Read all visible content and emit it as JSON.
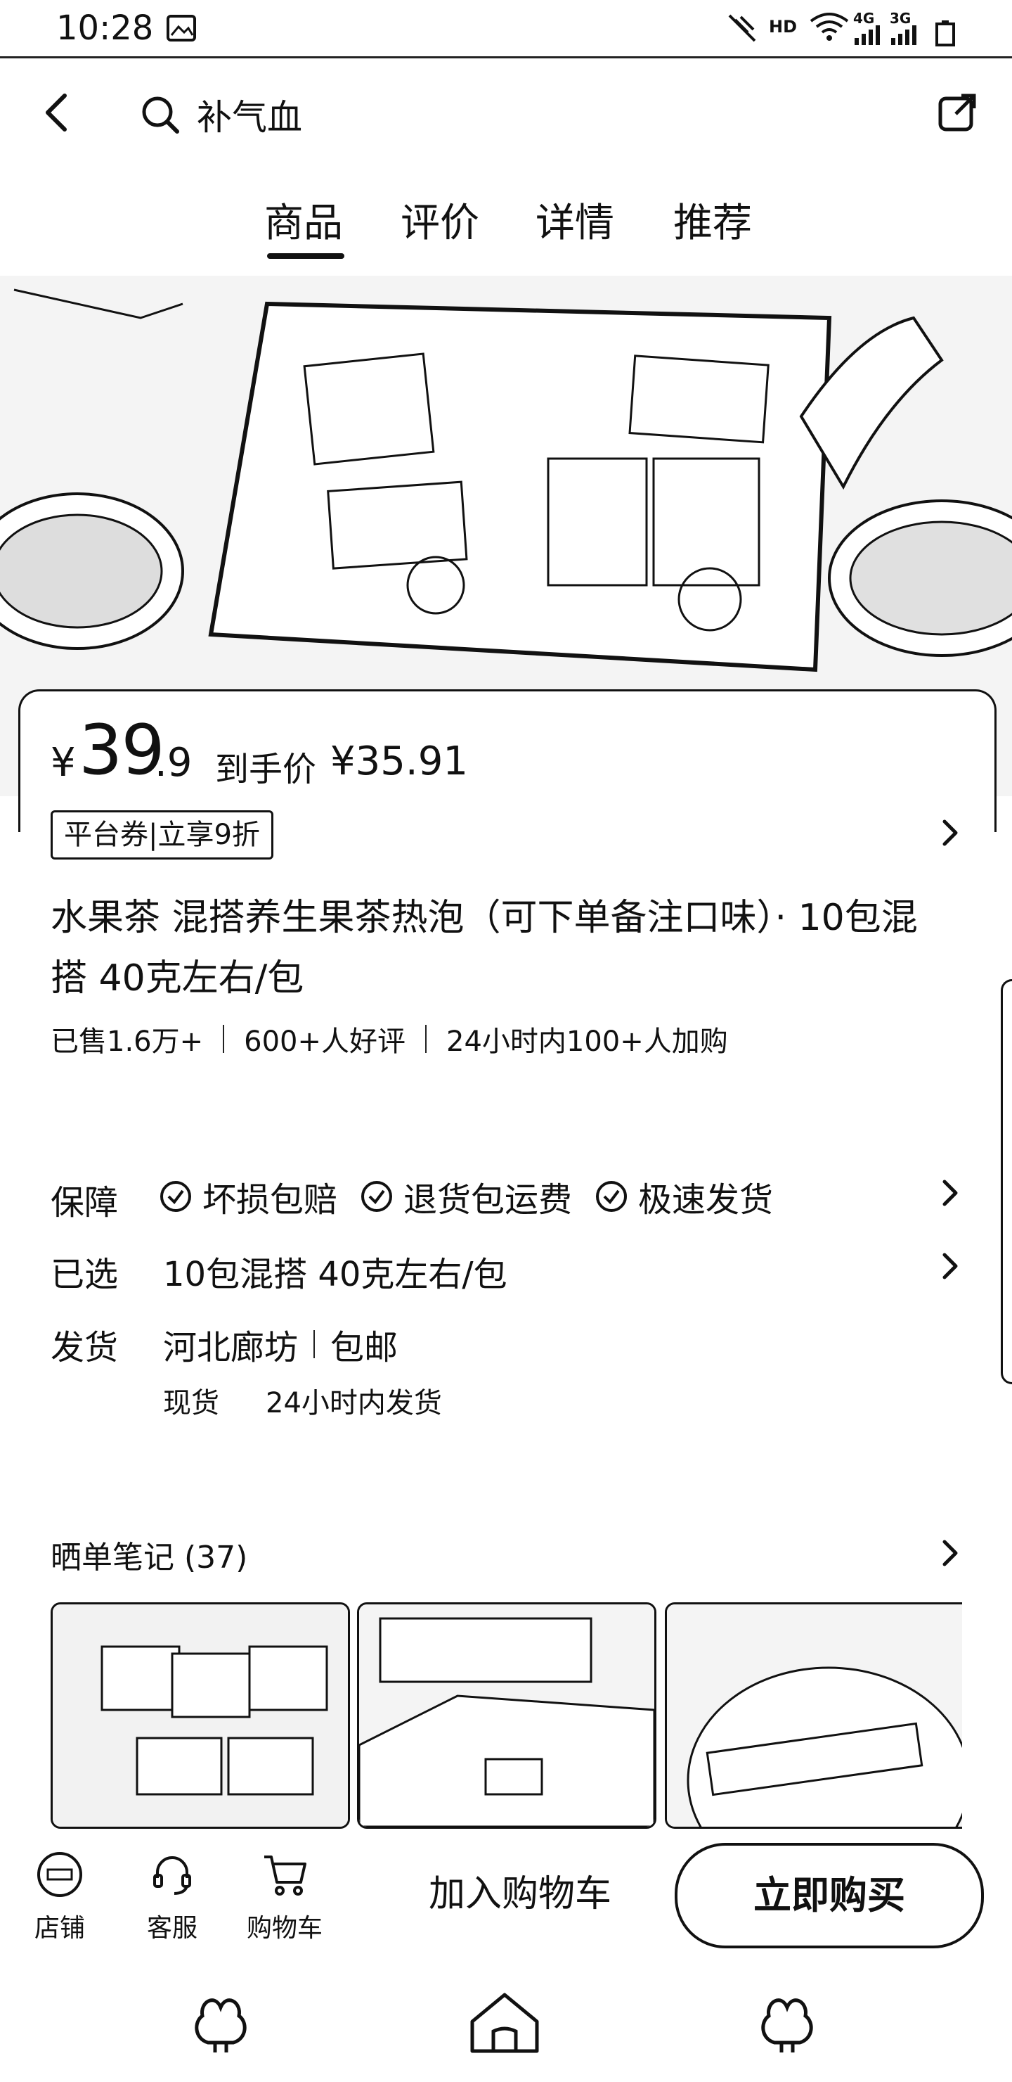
{
  "status_bar": {
    "time": "10:28",
    "network_hd": "HD",
    "net_4g": "4G",
    "net_3g": "3G"
  },
  "header": {
    "search_query": "补气血"
  },
  "tabs": [
    {
      "label": "商品"
    },
    {
      "label": "评价"
    },
    {
      "label": "详情"
    },
    {
      "label": "推荐"
    }
  ],
  "price": {
    "currency": "¥",
    "integer": "39",
    "decimal": ".9",
    "deal_label": "到手价",
    "deal_price": "¥35.91"
  },
  "coupon": {
    "text": "平台券|立享9折"
  },
  "product": {
    "title": "水果茶 混搭养生果茶热泡（可下单备注口味）· 10包混搭 40克左右/包"
  },
  "stats": [
    "已售1.6万+",
    "600+人好评",
    "24小时内100+人加购"
  ],
  "guarantee": {
    "label": "保障",
    "items": [
      "坏损包赔",
      "退货包运费",
      "极速发货"
    ]
  },
  "selected": {
    "label": "已选",
    "value": "10包混搭 40克左右/包"
  },
  "shipping": {
    "label": "发货",
    "origin": "河北廊坊",
    "fee": "包邮",
    "stock": "现货",
    "time": "24小时内发货"
  },
  "notes": {
    "title": "晒单笔记 (37)"
  },
  "action_bar": {
    "store": "店铺",
    "service": "客服",
    "cart": "购物车",
    "add_to_cart": "加入购物车",
    "buy_now": "立即购买"
  }
}
